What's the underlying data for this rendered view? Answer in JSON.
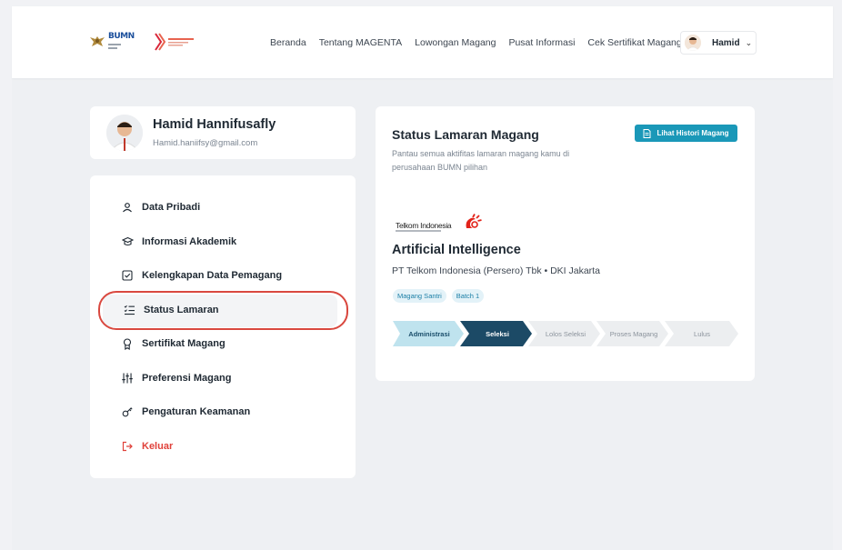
{
  "header": {
    "nav": [
      "Beranda",
      "Tentang MAGENTA",
      "Lowongan Magang",
      "Pusat Informasi",
      "Cek Sertifikat Magang"
    ],
    "user_name": "Hamid",
    "logo_text": "BUMN"
  },
  "profile": {
    "name": "Hamid Hannifusafly",
    "email": "Hamid.haniifsy@gmail.com"
  },
  "menu": {
    "items": [
      {
        "label": "Data Pribadi",
        "icon": "user-icon"
      },
      {
        "label": "Informasi Akademik",
        "icon": "graduation-cap-icon"
      },
      {
        "label": "Kelengkapan Data Pemagang",
        "icon": "checkbox-icon"
      },
      {
        "label": "Status Lamaran",
        "icon": "checklist-icon"
      },
      {
        "label": "Sertifikat Magang",
        "icon": "medal-icon"
      },
      {
        "label": "Preferensi Magang",
        "icon": "sliders-icon"
      },
      {
        "label": "Pengaturan Keamanan",
        "icon": "key-icon"
      },
      {
        "label": "Keluar",
        "icon": "logout-icon"
      }
    ],
    "active_index": 3
  },
  "status": {
    "title": "Status Lamaran Magang",
    "description": "Pantau semua aktifitas lamaran magang kamu di perusahaan BUMN pilihan",
    "history_button": "Lihat Histori Magang",
    "company_logo_text": "Telkom Indonesia",
    "job_title": "Artificial Intelligence",
    "company": "PT Telkom Indonesia (Persero) Tbk • DKI Jakarta",
    "tags": [
      "Magang Santri",
      "Batch 1"
    ],
    "steps": [
      "Administrasi",
      "Seleksi",
      "Lolos Seleksi",
      "Proses Magang",
      "Lulus"
    ],
    "current_step": 1
  },
  "colors": {
    "accent": "#1a98b8",
    "step_done": "#bfe3ee",
    "step_current": "#1c4a66",
    "step_pending": "#eceef0",
    "logout": "#e0413a",
    "highlight_ring": "#d9483f"
  }
}
